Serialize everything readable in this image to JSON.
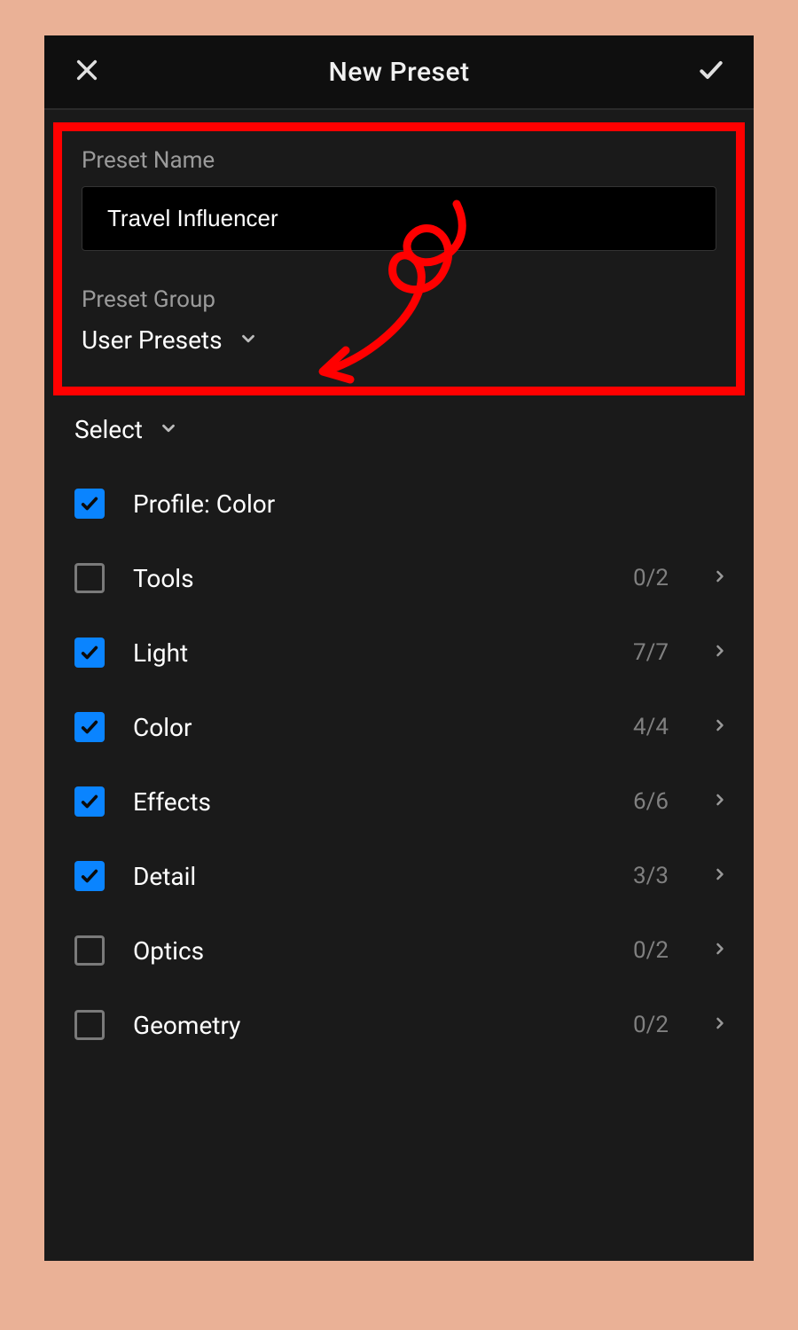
{
  "header": {
    "title": "New Preset"
  },
  "form": {
    "name_label": "Preset Name",
    "name_value": "Travel Influencer",
    "group_label": "Preset Group",
    "group_value": "User Presets"
  },
  "select": {
    "label": "Select"
  },
  "options": [
    {
      "label": "Profile: Color",
      "checked": true,
      "count": "",
      "expandable": false
    },
    {
      "label": "Tools",
      "checked": false,
      "count": "0/2",
      "expandable": true
    },
    {
      "label": "Light",
      "checked": true,
      "count": "7/7",
      "expandable": true
    },
    {
      "label": "Color",
      "checked": true,
      "count": "4/4",
      "expandable": true
    },
    {
      "label": "Effects",
      "checked": true,
      "count": "6/6",
      "expandable": true
    },
    {
      "label": "Detail",
      "checked": true,
      "count": "3/3",
      "expandable": true
    },
    {
      "label": "Optics",
      "checked": false,
      "count": "0/2",
      "expandable": true
    },
    {
      "label": "Geometry",
      "checked": false,
      "count": "0/2",
      "expandable": true
    }
  ]
}
